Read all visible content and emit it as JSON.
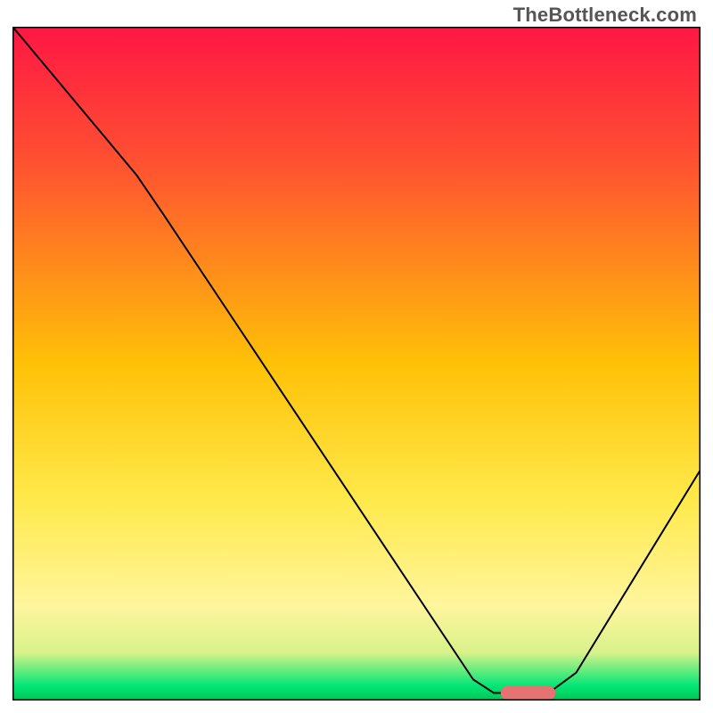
{
  "watermark": "TheBottleneck.com",
  "chart_data": {
    "type": "line",
    "title": "",
    "xlabel": "",
    "ylabel": "",
    "xlim": [
      0,
      100
    ],
    "ylim": [
      0,
      100
    ],
    "background_gradient": {
      "stops": [
        {
          "offset": 0,
          "color": "#ff1744"
        },
        {
          "offset": 20,
          "color": "#ff5131"
        },
        {
          "offset": 50,
          "color": "#ffc107"
        },
        {
          "offset": 70,
          "color": "#ffe94a"
        },
        {
          "offset": 86,
          "color": "#fff59d"
        },
        {
          "offset": 93,
          "color": "#d8f28a"
        },
        {
          "offset": 98,
          "color": "#00e676"
        },
        {
          "offset": 100,
          "color": "#00c853"
        }
      ]
    },
    "series": [
      {
        "name": "bottleneck-curve",
        "color": "#000000",
        "stroke_width": 2,
        "points": [
          {
            "x": 0,
            "y": 100
          },
          {
            "x": 18,
            "y": 78
          },
          {
            "x": 22,
            "y": 72
          },
          {
            "x": 67,
            "y": 3
          },
          {
            "x": 70,
            "y": 1
          },
          {
            "x": 78,
            "y": 1
          },
          {
            "x": 82,
            "y": 4
          },
          {
            "x": 100,
            "y": 34
          }
        ]
      }
    ],
    "marker": {
      "name": "optimal-range",
      "color": "#e57373",
      "x_start": 71,
      "x_end": 79,
      "y": 1,
      "height": 2
    },
    "axes": {
      "show_ticks": false,
      "frame": true,
      "frame_color": "#000000"
    }
  }
}
